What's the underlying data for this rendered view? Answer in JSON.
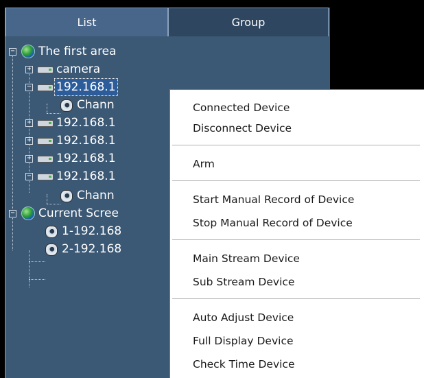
{
  "tabs": {
    "list": "List",
    "group": "Group"
  },
  "tree": {
    "area1": "The first area",
    "camera": "camera",
    "dev1": "192.168.1",
    "chan1": "Chann",
    "dev2": "192.168.1",
    "dev3": "192.168.1",
    "dev4": "192.168.1",
    "dev5": "192.168.1",
    "chan2": "Chann",
    "current": "Current Scree",
    "cur1": "1-192.168",
    "cur2": "2-192.168"
  },
  "menu": {
    "connected": "Connected Device",
    "disconnect": "Disconnect Device",
    "arm": "Arm",
    "start_record": "Start Manual Record of Device",
    "stop_record": "Stop Manual Record of Device",
    "main_stream": "Main Stream Device",
    "sub_stream": "Sub Stream Device",
    "auto_adjust": "Auto Adjust Device",
    "full_display": "Full Display Device",
    "check_time": "Check Time Device"
  },
  "icons": {
    "expand": "+",
    "collapse": "−"
  },
  "colors": {
    "panel_bg": "#3b5875",
    "tab_active": "#47668a",
    "tab_inactive": "#2f4660",
    "menu_bg": "#ffffff"
  }
}
